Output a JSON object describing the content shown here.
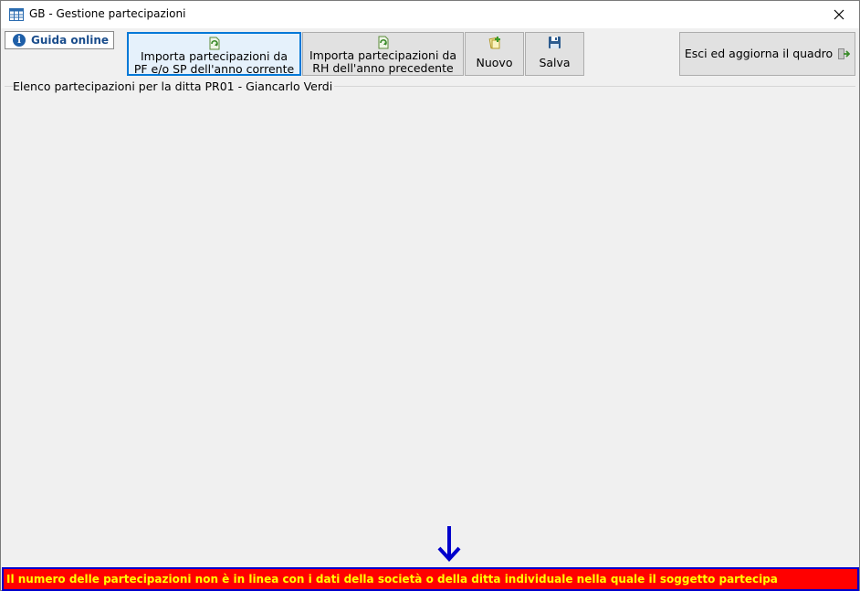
{
  "window": {
    "title": "GB - Gestione partecipazioni"
  },
  "toolbar": {
    "guida_label": "Guida online",
    "import_pf_line1": "Importa partecipazioni da",
    "import_pf_line2": "PF e/o SP dell'anno corrente",
    "import_rh_line1": "Importa partecipazioni da",
    "import_rh_line2": "RH dell'anno precedente",
    "nuovo_label": "Nuovo",
    "salva_label": "Salva",
    "esci_label": "Esci ed aggiorna il quadro"
  },
  "main": {
    "section_title": "Elenco partecipazioni per la ditta PR01 - Giancarlo Verdi"
  },
  "status": {
    "message": "Il numero delle partecipazioni non è in linea con i dati della società o della ditta individuale nella quale il soggetto partecipa"
  },
  "icons": {
    "app": "table-icon",
    "close": "close-icon",
    "info": "info-icon",
    "import": "import-icon",
    "new": "new-document-icon",
    "save": "floppy-disk-icon",
    "exit": "exit-door-icon",
    "arrow": "arrow-down-icon"
  },
  "colors": {
    "status_background": "#ff0000",
    "status_text": "#ffff00",
    "status_border": "#0000cc",
    "arrow": "#0000cc",
    "focus_border": "#0078d7"
  }
}
